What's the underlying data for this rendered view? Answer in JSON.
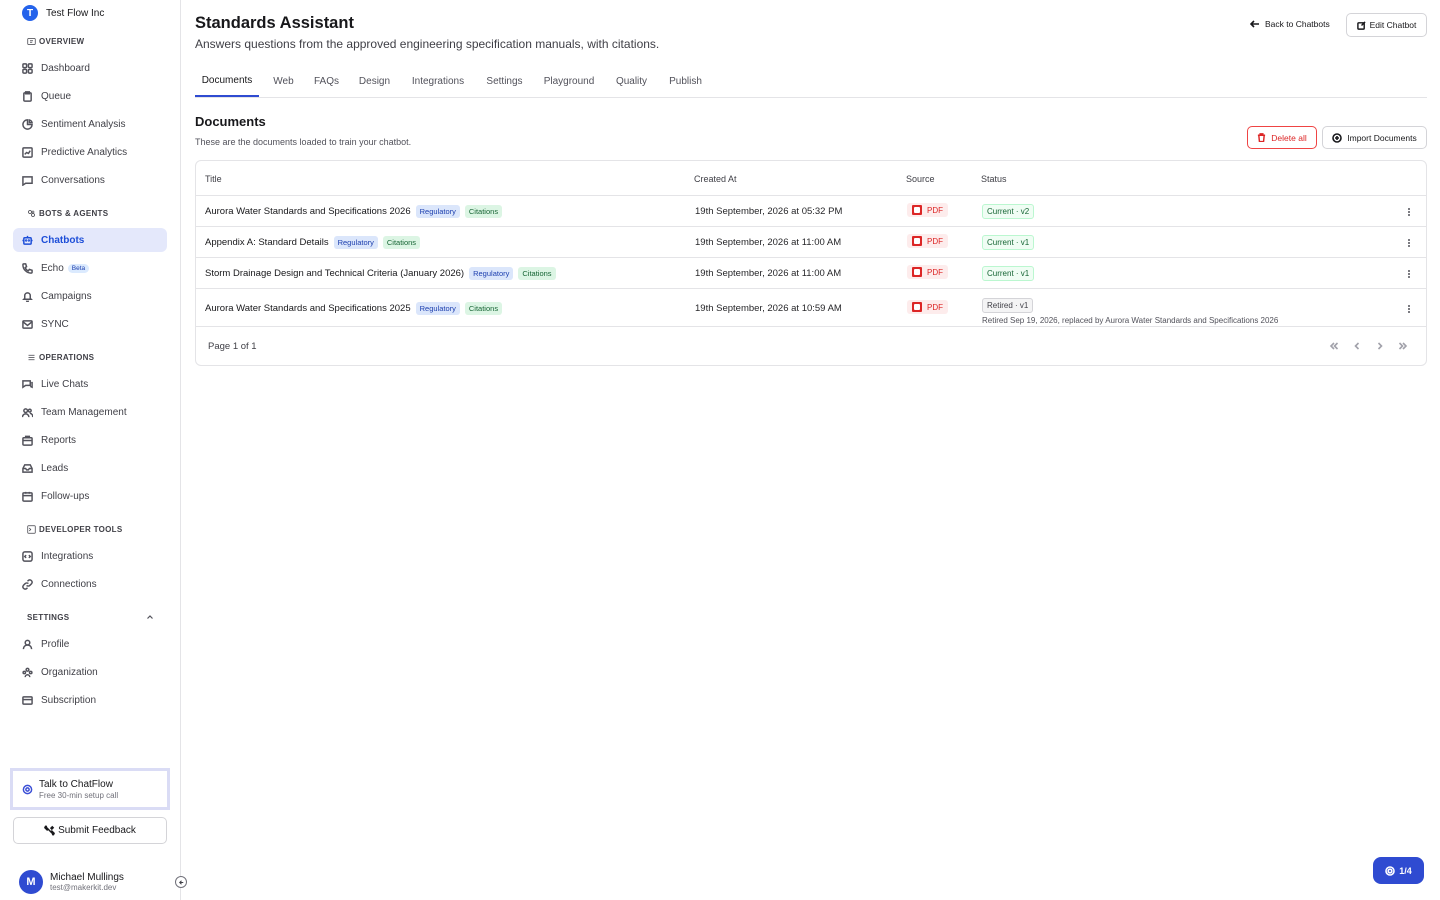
{
  "sidebar": {
    "org_initial": "T",
    "org_name": "Test Flow Inc",
    "sections": {
      "overview": "OVERVIEW",
      "bots": "BOTS & AGENTS",
      "operations": "OPERATIONS",
      "devtools": "DEVELOPER TOOLS",
      "settings": "SETTINGS"
    },
    "items": {
      "dashboard": "Dashboard",
      "queue": "Queue",
      "sentiment": "Sentiment Analysis",
      "predictive": "Predictive Analytics",
      "conversations": "Conversations",
      "chatbots": "Chatbots",
      "echo": "Echo",
      "echo_badge": "Beta",
      "campaigns": "Campaigns",
      "sync": "SYNC",
      "live_chats": "Live Chats",
      "team": "Team Management",
      "reports": "Reports",
      "leads": "Leads",
      "followups": "Follow-ups",
      "integrations": "Integrations",
      "connections": "Connections",
      "profile": "Profile",
      "organization": "Organization",
      "subscription": "Subscription"
    },
    "talk_title": "Talk to ChatFlow",
    "talk_sub": "Free 30-min setup call",
    "feedback_label": "Submit Feedback",
    "user_initial": "M",
    "user_name": "Michael Mullings",
    "user_email": "test@makerkit.dev"
  },
  "header": {
    "title": "Standards Assistant",
    "subtitle": "Answers questions from the approved engineering specification manuals, with citations.",
    "back_label": "Back to Chatbots",
    "edit_label": "Edit Chatbot"
  },
  "tabs": [
    "Documents",
    "Web",
    "FAQs",
    "Design",
    "Integrations",
    "Settings",
    "Playground",
    "Quality",
    "Publish"
  ],
  "documents": {
    "title": "Documents",
    "subtitle": "These are the documents loaded to train your chatbot.",
    "delete_label": "Delete all",
    "import_label": "Import Documents",
    "columns": {
      "title": "Title",
      "created": "Created At",
      "source": "Source",
      "status": "Status"
    },
    "rows": [
      {
        "title": "Aurora Water Standards and Specifications 2026",
        "tag1": "Regulatory",
        "tag2": "Citations",
        "created": "19th September, 2026 at 05:32 PM",
        "source": "PDF",
        "status": "Current · v2"
      },
      {
        "title": "Appendix A: Standard Details",
        "tag1": "Regulatory",
        "tag2": "Citations",
        "created": "19th September, 2026 at 11:00 AM",
        "source": "PDF",
        "status": "Current · v1"
      },
      {
        "title": "Storm Drainage Design and Technical Criteria (January 2026)",
        "tag1": "Regulatory",
        "tag2": "Citations",
        "created": "19th September, 2026 at 11:00 AM",
        "source": "PDF",
        "status": "Current · v1"
      },
      {
        "title": "Aurora Water Standards and Specifications 2025",
        "tag1": "Regulatory",
        "tag2": "Citations",
        "created": "19th September, 2026 at 10:59 AM",
        "source": "PDF",
        "status": "Retired · v1",
        "note": "Retired Sep 19, 2026, replaced by Aurora Water Standards and Specifications 2026"
      }
    ],
    "pager": "Page 1 of 1"
  },
  "float_label": "1/4",
  "colors": {
    "accent": "#2f4bd1",
    "danger": "#dc2626",
    "success": "#166534"
  }
}
